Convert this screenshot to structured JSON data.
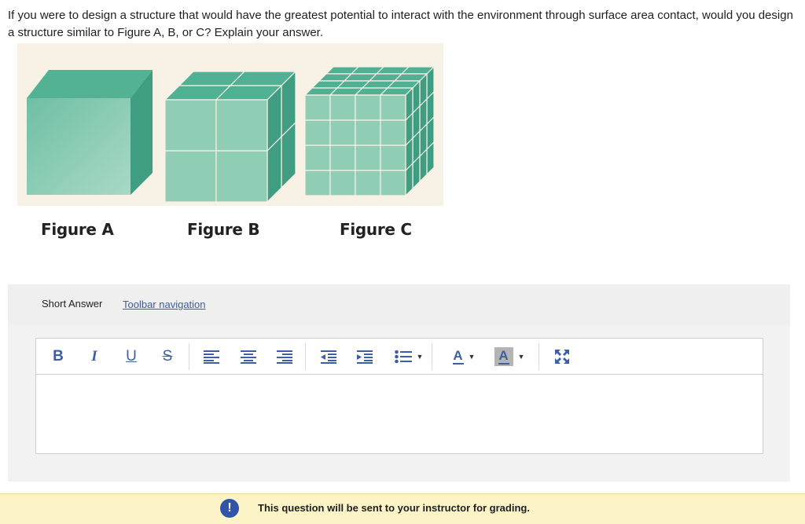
{
  "question": {
    "text": "If you were to design a structure that would have the greatest potential to interact with the environment through surface area contact, would you design a structure similar to Figure A, B, or C? Explain your answer."
  },
  "figures": {
    "labels": [
      "Figure A",
      "Figure B",
      "Figure C"
    ]
  },
  "answer": {
    "type_label": "Short Answer",
    "toolbar_link": "Toolbar navigation"
  },
  "toolbar": {
    "bold": "B",
    "italic": "I",
    "underline": "U",
    "strikethrough": "S",
    "font_color": "A",
    "highlight_color": "A"
  },
  "notice": {
    "icon": "!",
    "text": "This question will be sent to your instructor for grading."
  },
  "colors": {
    "cube_front": "#8fcdb5",
    "cube_top": "#4fb093",
    "cube_side": "#3f9e82",
    "toolbar_icon": "#3b5ea6",
    "notice_bg": "#fcf3c6",
    "notice_icon": "#3154a8"
  }
}
